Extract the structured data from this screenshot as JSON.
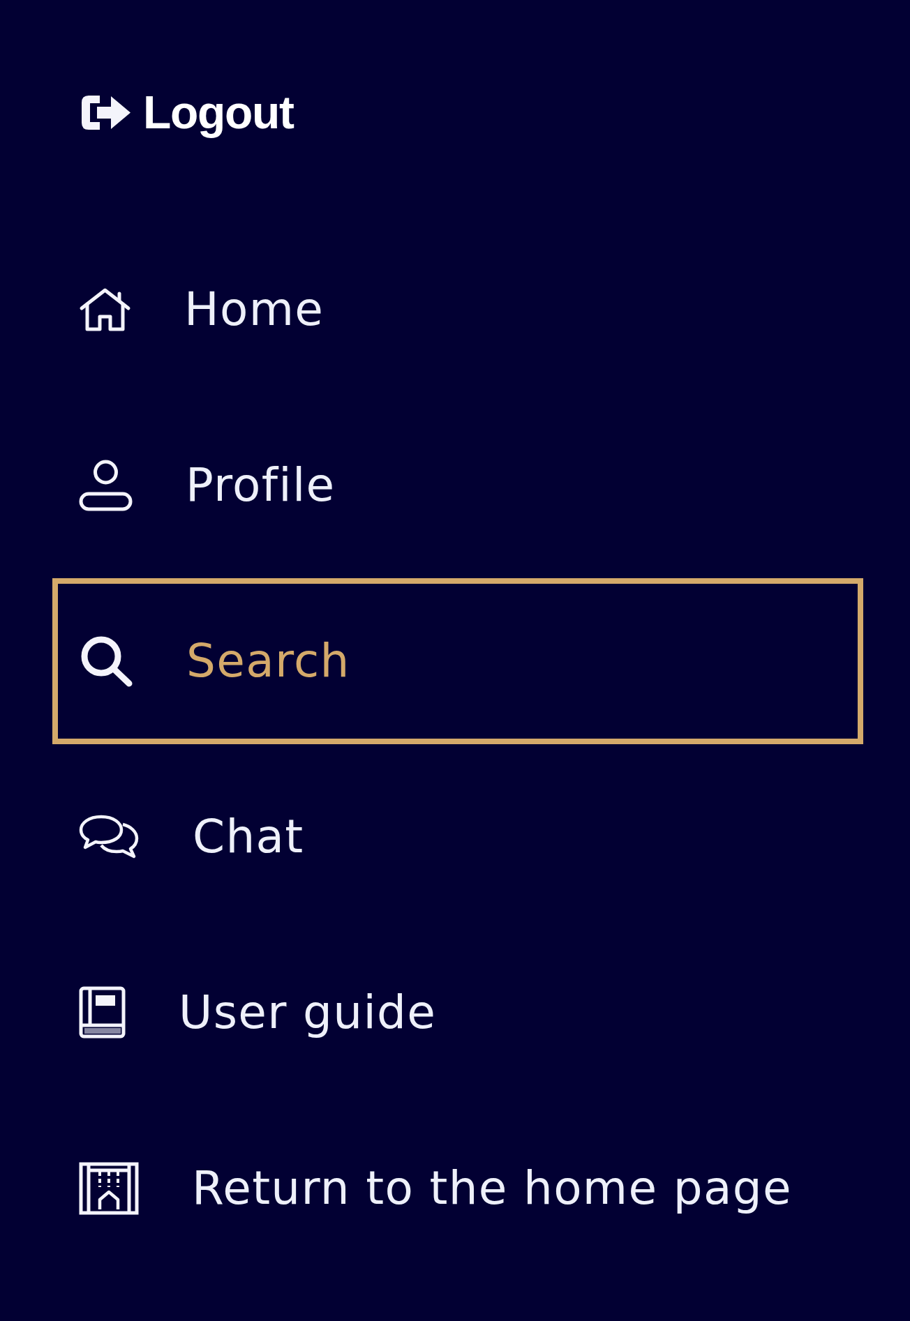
{
  "logout": {
    "label": "Logout"
  },
  "nav": {
    "items": [
      {
        "kind": "home",
        "label": "Home",
        "selected": false
      },
      {
        "kind": "profile",
        "label": "Profile",
        "selected": false
      },
      {
        "kind": "search",
        "label": "Search",
        "selected": true
      },
      {
        "kind": "chat",
        "label": "Chat",
        "selected": false
      },
      {
        "kind": "guide",
        "label": "User guide",
        "selected": false
      },
      {
        "kind": "return",
        "label": "Return to the home page",
        "selected": false
      }
    ]
  }
}
